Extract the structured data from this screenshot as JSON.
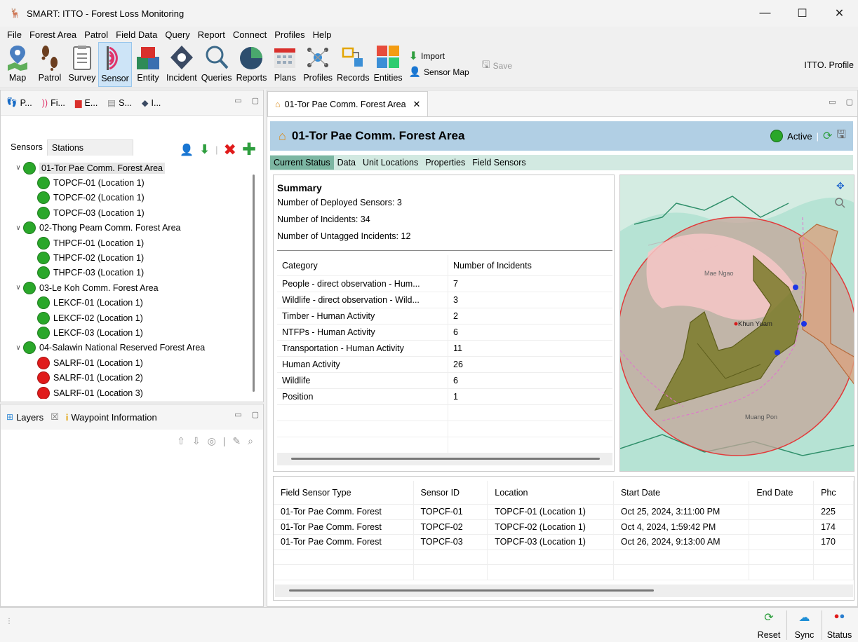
{
  "window": {
    "title": "SMART: ITTO - Forest Loss Monitoring",
    "controls": [
      "—",
      "☐",
      "✕"
    ]
  },
  "menu": [
    "File",
    "Forest Area",
    "Patrol",
    "Field Data",
    "Query",
    "Report",
    "Connect",
    "Profiles",
    "Help"
  ],
  "toolbar": {
    "buttons": [
      {
        "label": "Map",
        "icon": "map-pin-icon"
      },
      {
        "label": "Patrol",
        "icon": "footprints-icon"
      },
      {
        "label": "Survey",
        "icon": "clipboard-icon"
      },
      {
        "label": "Sensor",
        "icon": "sensor-wave-icon",
        "active": true
      },
      {
        "label": "Entity",
        "icon": "entity-blocks-icon"
      },
      {
        "label": "Incident",
        "icon": "incident-diamond-icon"
      },
      {
        "label": "Queries",
        "icon": "magnifier-icon"
      },
      {
        "label": "Reports",
        "icon": "pie-chart-icon"
      },
      {
        "label": "Plans",
        "icon": "calendar-icon"
      },
      {
        "label": "Profiles",
        "icon": "profiles-network-icon"
      },
      {
        "label": "Records",
        "icon": "records-icon"
      },
      {
        "label": "Entities",
        "icon": "entities-grid-icon"
      }
    ],
    "import_label": "Import",
    "sensor_map_label": "Sensor Map",
    "save_label": "Save",
    "profile_label": "ITTO. Profile"
  },
  "left_panel": {
    "tabs": [
      "P...",
      "Fi...",
      "E...",
      "S...",
      "I..."
    ],
    "subtabs": [
      "Sensors",
      "Stations"
    ],
    "tree": [
      {
        "label": "01-Tor Pae Comm. Forest Area",
        "level": 0,
        "status": "green",
        "selected": true
      },
      {
        "label": "TOPCF-01 (Location 1)",
        "level": 1,
        "status": "green"
      },
      {
        "label": "TOPCF-02 (Location 1)",
        "level": 1,
        "status": "green"
      },
      {
        "label": "TOPCF-03 (Location 1)",
        "level": 1,
        "status": "green"
      },
      {
        "label": "02-Thong Peam Comm. Forest Area",
        "level": 0,
        "status": "green"
      },
      {
        "label": "THPCF-01 (Location 1)",
        "level": 1,
        "status": "green"
      },
      {
        "label": "THPCF-02 (Location 1)",
        "level": 1,
        "status": "green"
      },
      {
        "label": "THPCF-03 (Location 1)",
        "level": 1,
        "status": "green"
      },
      {
        "label": "03-Le Koh Comm. Forest Area",
        "level": 0,
        "status": "green"
      },
      {
        "label": "LEKCF-01 (Location 1)",
        "level": 1,
        "status": "green"
      },
      {
        "label": "LEKCF-02 (Location 1)",
        "level": 1,
        "status": "green"
      },
      {
        "label": "LEKCF-03 (Location 1)",
        "level": 1,
        "status": "green"
      },
      {
        "label": "04-Salawin National Reserved Forest Area",
        "level": 0,
        "status": "green"
      },
      {
        "label": "SALRF-01 (Location 1)",
        "level": 1,
        "status": "red"
      },
      {
        "label": "SALRF-01 (Location 2)",
        "level": 1,
        "status": "red"
      },
      {
        "label": "SALRF-01 (Location 3)",
        "level": 1,
        "status": "red"
      }
    ]
  },
  "layers_panel": {
    "tab1": "Layers",
    "tab1_close": "☒",
    "tab2": "Waypoint Information"
  },
  "editor": {
    "tab_title": "01-Tor Pae Comm. Forest Area",
    "header_title": "01-Tor Pae Comm. Forest Area",
    "status_label": "Active",
    "subtabs": [
      "Current Status",
      "Data",
      "Unit Locations",
      "Properties",
      "Field Sensors"
    ],
    "summary": {
      "heading": "Summary",
      "deployed": "Number of Deployed Sensors: 3",
      "incidents": "Number of Incidents: 34",
      "untagged": "Number of Untagged Incidents: 12",
      "col1": "Category",
      "col2": "Number of Incidents",
      "rows": [
        [
          "People - direct observation - Hum...",
          "7"
        ],
        [
          "Wildlife - direct observation - Wild...",
          "3"
        ],
        [
          "Timber - Human Activity",
          "2"
        ],
        [
          "NTFPs - Human Activity",
          "6"
        ],
        [
          "Transportation - Human Activity",
          "11"
        ],
        [
          "Human Activity",
          "26"
        ],
        [
          "Wildlife",
          "6"
        ],
        [
          "Position",
          "1"
        ]
      ]
    },
    "map": {
      "labels": [
        "Mae Ngao",
        "Khun Yuam",
        "Muang Pon"
      ]
    },
    "field_sensors": {
      "headers": [
        "Field Sensor Type",
        "Sensor ID",
        "Location",
        "Start Date",
        "End Date",
        "Phc"
      ],
      "rows": [
        [
          "01-Tor Pae Comm. Forest",
          "TOPCF-01",
          "TOPCF-01 (Location 1)",
          "Oct 25, 2024, 3:11:00 PM",
          "",
          "225"
        ],
        [
          "01-Tor Pae Comm. Forest",
          "TOPCF-02",
          "TOPCF-02 (Location 1)",
          "Oct 4, 2024, 1:59:42 PM",
          "",
          "174"
        ],
        [
          "01-Tor Pae Comm. Forest",
          "TOPCF-03",
          "TOPCF-03 (Location 1)",
          "Oct 26, 2024, 9:13:00 AM",
          "",
          "170"
        ]
      ]
    }
  },
  "statusbar": {
    "reset": "Reset",
    "sync": "Sync",
    "status": "Status"
  },
  "colors": {
    "active_green": "#2aa72a",
    "offline_red": "#e01b1b",
    "header_blue": "#b1cfe4",
    "subtab_green": "#7cb6a2"
  }
}
